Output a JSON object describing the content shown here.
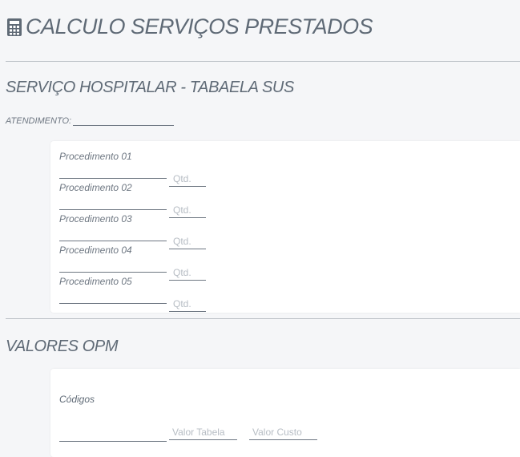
{
  "page": {
    "title": "CALCULO SERVIÇOS PRESTADOS",
    "title_icon": "calculator-icon"
  },
  "hospitalar": {
    "title": "SERVIÇO HOSPITALAR - TABAELA SUS",
    "atendimento_label": "ATENDIMENTO:",
    "atendimento_value": "",
    "procedimentos": [
      {
        "label": "Procedimento 01",
        "value": "",
        "qtd_placeholder": "Qtd."
      },
      {
        "label": "Procedimento 02",
        "value": "",
        "qtd_placeholder": "Qtd."
      },
      {
        "label": "Procedimento 03",
        "value": "",
        "qtd_placeholder": "Qtd."
      },
      {
        "label": "Procedimento 04",
        "value": "",
        "qtd_placeholder": "Qtd."
      },
      {
        "label": "Procedimento 05",
        "value": "",
        "qtd_placeholder": "Qtd."
      }
    ]
  },
  "opm": {
    "title": "VALORES OPM",
    "codigos_label": "Códigos",
    "codigo_value": "",
    "valor_tabela_placeholder": "Valor Tabela",
    "valor_custo_placeholder": "Valor Custo"
  },
  "colors": {
    "background": "#f5f6f8",
    "panel": "#ffffff",
    "text": "#5f6a76",
    "divider": "#b9bec4"
  }
}
